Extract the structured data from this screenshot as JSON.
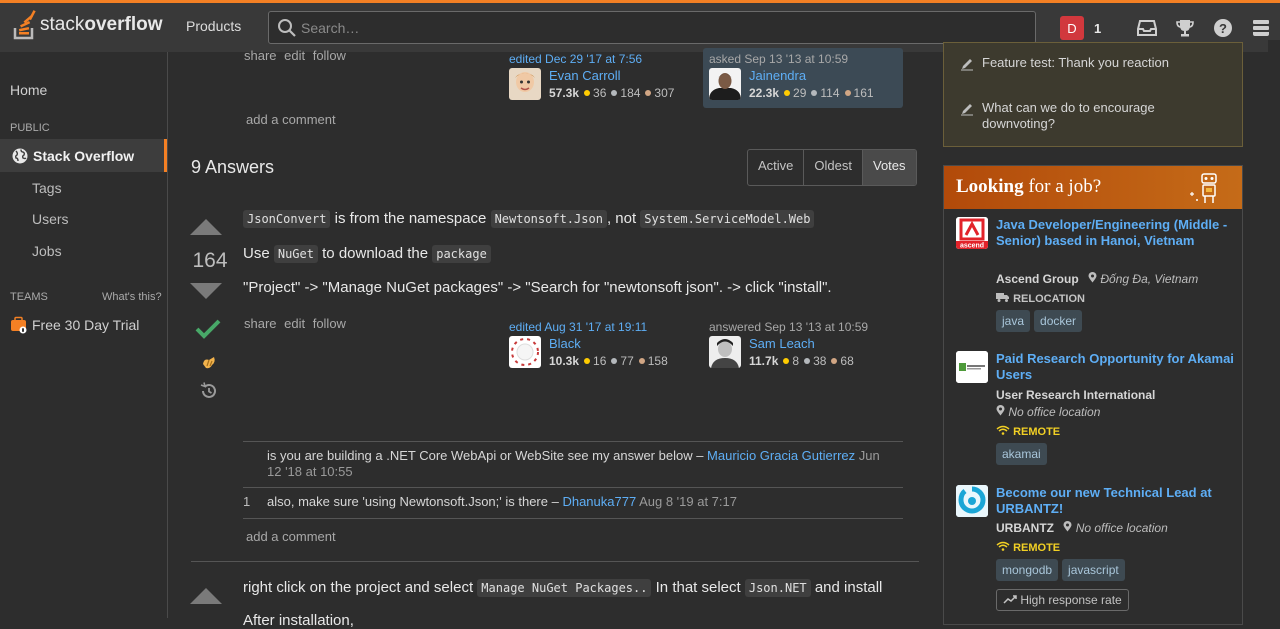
{
  "header": {
    "logo_text_light": "stack",
    "logo_text_bold": "overflow",
    "products": "Products",
    "search_placeholder": "Search…",
    "avatar_letter": "D",
    "reputation": "1"
  },
  "leftnav": {
    "home": "Home",
    "public": "PUBLIC",
    "stack_overflow": "Stack Overflow",
    "tags": "Tags",
    "users": "Users",
    "jobs": "Jobs",
    "teams": "TEAMS",
    "whats_this": "What's this?",
    "trial": "Free 30 Day Trial"
  },
  "question": {
    "actions": "share edit follow",
    "edited": "edited Dec 29 '17 at 7:56",
    "editor_name": "Evan Carroll",
    "editor_rep": "57.3k",
    "editor_gold": "36",
    "editor_silver": "184",
    "editor_bronze": "307",
    "asked": "asked Sep 13 '13 at 10:59",
    "asker_name": "Jainendra",
    "asker_rep": "22.3k",
    "asker_gold": "29",
    "asker_silver": "114",
    "asker_bronze": "161",
    "add_comment": "add a comment"
  },
  "answers": {
    "heading": "9 Answers",
    "tabs": [
      "Active",
      "Oldest",
      "Votes"
    ]
  },
  "answer1": {
    "score": "164",
    "p1_code1": "JsonConvert",
    "p1_t1": " is from the namespace ",
    "p1_code2": "Newtonsoft.Json",
    "p1_t2": ", not ",
    "p1_code3": "System.ServiceModel.Web",
    "p2_t1": "Use ",
    "p2_code1": "NuGet",
    "p2_t2": " to download the ",
    "p2_code2": "package",
    "p3": "\"Project\" -> \"Manage NuGet packages\" -> \"Search for \"newtonsoft json\". -> click \"install\".",
    "actions": "share edit follow",
    "edited": "edited Aug 31 '17 at 19:11",
    "editor_name": "Black",
    "editor_rep": "10.3k",
    "editor_gold": "16",
    "editor_silver": "77",
    "editor_bronze": "158",
    "answered": "answered Sep 13 '13 at 10:59",
    "answerer_name": "Sam Leach",
    "answerer_rep": "11.7k",
    "answerer_gold": "8",
    "answerer_silver": "38",
    "answerer_bronze": "68",
    "comment1_text": "is you are building a .NET Core WebApi or WebSite see my answer below – ",
    "comment1_user": "Mauricio Gracia Gutierrez",
    "comment1_date": " Jun 12 '18 at 10:55",
    "comment2_votes": "1",
    "comment2_text": "also, make sure 'using Newtonsoft.Json;' is there – ",
    "comment2_user": "Dhanuka777",
    "comment2_date": " Aug 8 '19 at 7:17",
    "add_comment": "add a comment"
  },
  "answer2": {
    "t1": "right click on the project and select ",
    "code1": "Manage NuGet Packages..",
    "t2": " In that select ",
    "code2": "Json.NET",
    "t3": " and install",
    "t4": "After installation,"
  },
  "sidebar": {
    "feat1": "Feature test: Thank you reaction",
    "feat2": "What can we do to encourage downvoting?",
    "jobs_title_bold": "Looking",
    "jobs_title_rest": " for a job?",
    "job1_title": "Java Developer/Engineering (Middle - Senior) based in Hanoi, Vietnam",
    "job1_company": "Ascend Group",
    "job1_location": "Đống Đa, Vietnam",
    "job1_flag": "RELOCATION",
    "job1_logo_text": "ascend",
    "job1_tags": [
      "java",
      "docker"
    ],
    "job2_title": "Paid Research Opportunity for Akamai Users",
    "job2_company": "User Research International",
    "job2_location": "No office location",
    "job2_flag": "REMOTE",
    "job2_tags": [
      "akamai"
    ],
    "job3_title": "Become our new Technical Lead at URBANTZ!",
    "job3_company": "URBANTZ",
    "job3_location": "No office location",
    "job3_flag": "REMOTE",
    "job3_tags": [
      "mongodb",
      "javascript"
    ],
    "job3_badge": "High response rate"
  }
}
